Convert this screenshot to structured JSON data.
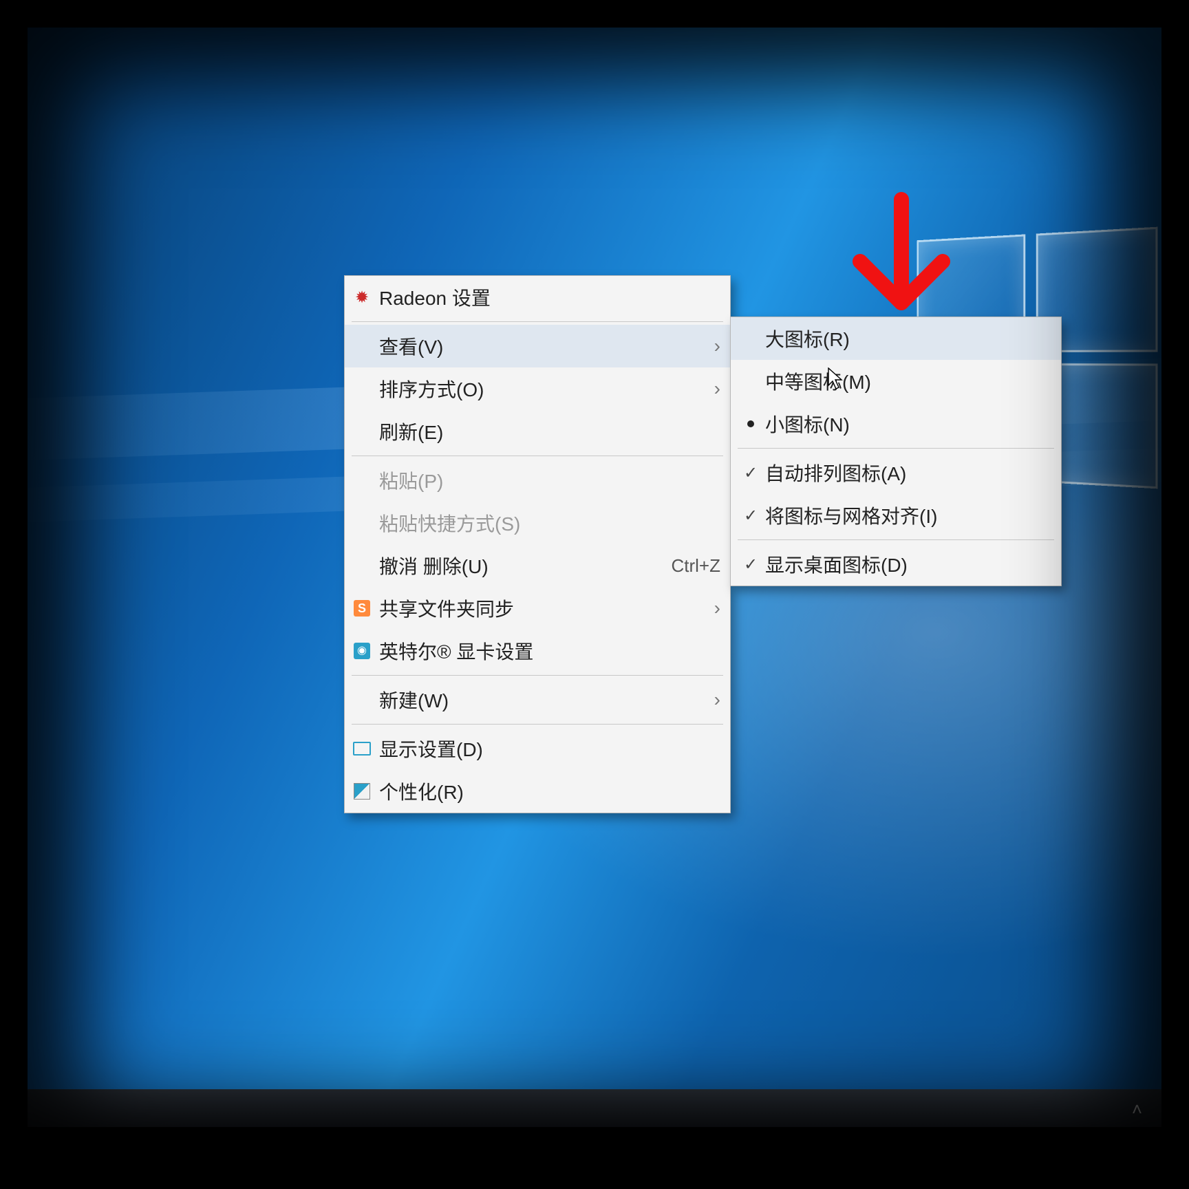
{
  "contextMenu": {
    "radeon": "Radeon 设置",
    "view": "查看(V)",
    "sort": "排序方式(O)",
    "refresh": "刷新(E)",
    "paste": "粘贴(P)",
    "pasteShortcut": "粘贴快捷方式(S)",
    "undoDelete": "撤消 删除(U)",
    "undoDeleteKey": "Ctrl+Z",
    "shareSync": "共享文件夹同步",
    "intel": "英特尔® 显卡设置",
    "new": "新建(W)",
    "displaySettings": "显示设置(D)",
    "personalize": "个性化(R)"
  },
  "viewSubmenu": {
    "largeIcons": "大图标(R)",
    "mediumIcons": "中等图标(M)",
    "smallIcons": "小图标(N)",
    "autoArrange": "自动排列图标(A)",
    "alignGrid": "将图标与网格对齐(I)",
    "showDesktop": "显示桌面图标(D)"
  },
  "arrowGlyph": "›"
}
